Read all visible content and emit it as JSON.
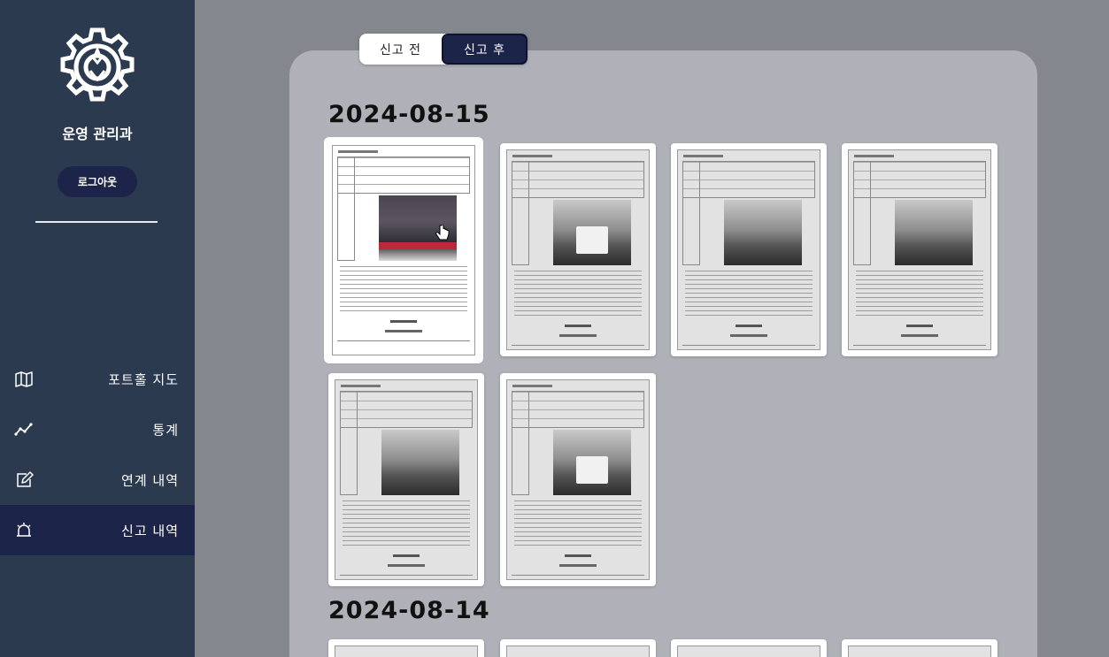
{
  "sidebar": {
    "logo_icon": "gear-emblem-icon",
    "dept_name": "운영 관리과",
    "logout_label": "로그아웃",
    "nav": [
      {
        "label": "포트홀 지도",
        "icon": "map-icon",
        "active": false
      },
      {
        "label": "통계",
        "icon": "chart-line-icon",
        "active": false
      },
      {
        "label": "연계 내역",
        "icon": "edit-doc-icon",
        "active": false
      },
      {
        "label": "신고 내역",
        "icon": "alarm-icon",
        "active": true
      }
    ]
  },
  "tabs": [
    {
      "label": "신고 전",
      "active": false
    },
    {
      "label": "신고 후",
      "active": true
    }
  ],
  "groups": [
    {
      "date": "2024-08-15",
      "documents": 6
    },
    {
      "date": "2024-08-14",
      "documents": 4
    }
  ],
  "colors": {
    "sidebar_bg": "#2b3a4f",
    "accent_navy": "#1c2449",
    "panel_bg": "#b0b1b8",
    "page_bg": "#85878f"
  }
}
